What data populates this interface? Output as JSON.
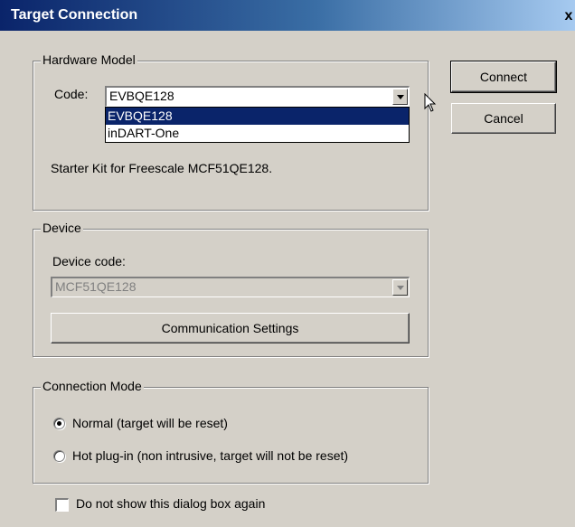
{
  "window": {
    "title": "Target Connection",
    "close_glyph": "x"
  },
  "hardware_model": {
    "legend": "Hardware Model",
    "code_label": "Code:",
    "code_value": "EVBQE128",
    "options": [
      "EVBQE128",
      "inDART-One"
    ],
    "selected_option": "EVBQE128",
    "description": "Starter Kit for Freescale MCF51QE128."
  },
  "device": {
    "legend": "Device",
    "code_label": "Device code:",
    "code_value": "MCF51QE128",
    "comm_button": "Communication Settings"
  },
  "connection_mode": {
    "legend": "Connection Mode",
    "options": [
      {
        "label": "Normal (target will be reset)",
        "checked": true
      },
      {
        "label": "Hot plug-in (non intrusive, target will not be reset)",
        "checked": false
      }
    ]
  },
  "footer": {
    "dont_show_label": "Do not show this dialog box again",
    "dont_show_checked": false
  },
  "buttons": {
    "connect": "Connect",
    "cancel": "Cancel"
  },
  "colors": {
    "dialog_bg": "#d4d0c8",
    "title_start": "#0a246a",
    "title_end": "#a6caf0",
    "selection": "#0a246a"
  }
}
